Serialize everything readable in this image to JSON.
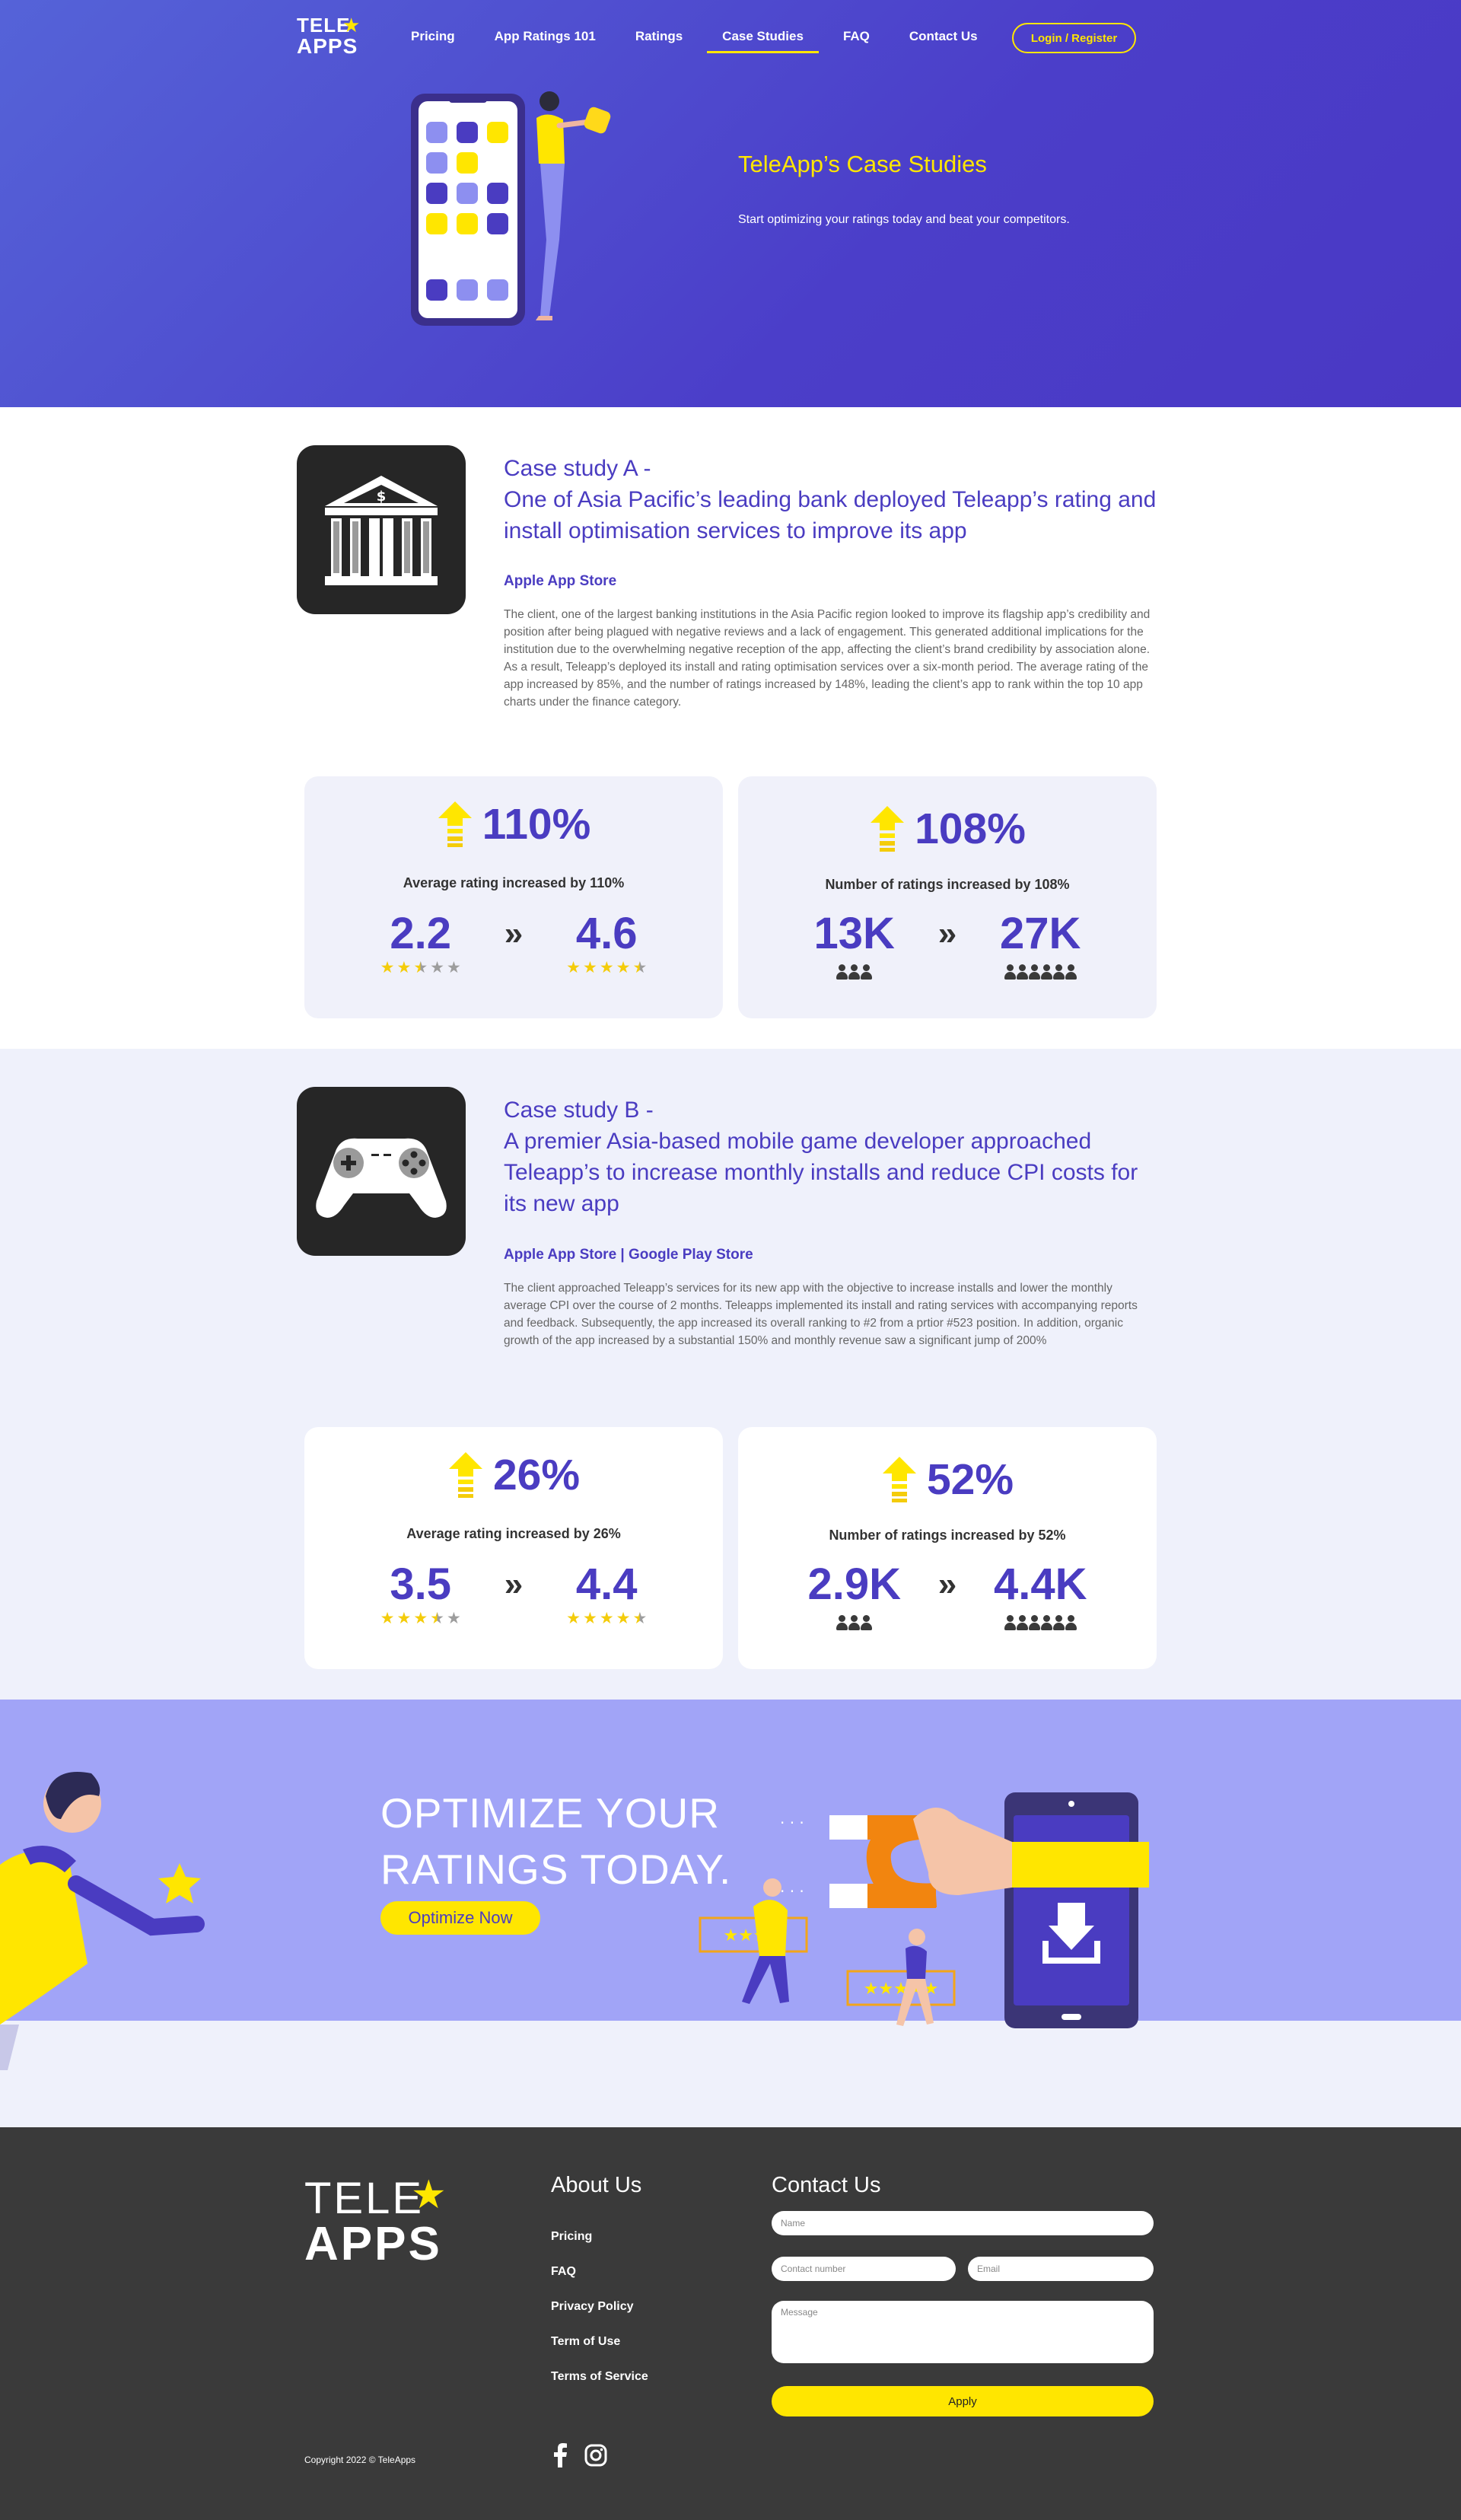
{
  "brand": {
    "logo_line1": "TELE",
    "logo_line2": "APPS"
  },
  "nav": {
    "items": [
      {
        "label": "Pricing"
      },
      {
        "label": "App Ratings 101"
      },
      {
        "label": "Ratings"
      },
      {
        "label": "Case Studies",
        "active": true
      },
      {
        "label": "FAQ"
      },
      {
        "label": "Contact Us"
      }
    ],
    "login_label": "Login / Register"
  },
  "hero": {
    "title": "TeleApp’s Case Studies",
    "subtitle": "Start optimizing your ratings today and beat your competitors."
  },
  "case_a": {
    "icon": "bank-icon",
    "title_line1": "Case study A -",
    "title_line2": "One of Asia Pacific’s leading bank deployed Teleapp’s rating and install optimisation services to improve its app",
    "store": "Apple App Store",
    "body_p1": "The client, one of the largest banking institutions in the Asia Pacific region looked to improve its flagship app’s credibility and position after being plagued with negative reviews and a lack of engagement. This generated additional implications for the institution due to the overwhelming negative reception of the app, affecting the client’s brand credibility by association alone.",
    "body_p2": "As a result, Teleapp’s deployed its install and rating optimisation services over a six-month period. The average rating of the app increased by 85%, and the number of ratings increased by 148%, leading the client’s app to rank within the top 10 app charts under the finance category.",
    "stat1": {
      "pct": "110%",
      "label": "Average rating increased by 110%",
      "from": "2.2",
      "to": "4.6",
      "from_stars": 2.5,
      "to_stars": 4.5
    },
    "stat2": {
      "pct": "108%",
      "label": "Number of ratings increased by 108%",
      "from": "13K",
      "to": "27K",
      "from_people": 3,
      "to_people": 6
    }
  },
  "case_b": {
    "icon": "gamepad-icon",
    "title_line1": "Case study B -",
    "title_line2": "A premier Asia-based mobile game developer approached Teleapp’s to increase monthly installs and reduce CPI costs for its new app",
    "store": "Apple App Store | Google Play Store",
    "body_p1": "The client approached Teleapp’s services for its new app with the objective to increase installs and lower the monthly average CPI over the course of 2 months. Teleapps implemented its install and rating services with accompanying reports and feedback. Subsequently, the app increased its overall ranking to #2 from a prtior #523 position. In addition, organic growth of the app increased by a substantial 150% and monthly revenue saw a significant jump of 200%",
    "stat1": {
      "pct": "26%",
      "label": "Average rating increased by 26%",
      "from": "3.5",
      "to": "4.4",
      "from_stars": 3.5,
      "to_stars": 4.5
    },
    "stat2": {
      "pct": "52%",
      "label": "Number of ratings increased by 52%",
      "from": "2.9K",
      "to": "4.4K",
      "from_people": 3,
      "to_people": 6
    }
  },
  "cta": {
    "title_line1": "OPTIMIZE YOUR",
    "title_line2": "RATINGS TODAY.",
    "button": "Optimize Now"
  },
  "footer": {
    "about_title": "About Us",
    "links": [
      {
        "label": "Pricing"
      },
      {
        "label": "FAQ"
      },
      {
        "label": "Privacy Policy"
      },
      {
        "label": "Term of Use"
      },
      {
        "label": "Terms of Service"
      }
    ],
    "contact_title": "Contact Us",
    "name_placeholder": "Name",
    "contact_placeholder": "Contact number",
    "email_placeholder": "Email",
    "message_placeholder": "Message",
    "apply": "Apply",
    "copyright": "Copyright 2022 © TeleApps",
    "social": [
      "facebook-icon",
      "instagram-icon"
    ]
  },
  "colors": {
    "primary": "#4a3cc1",
    "accent": "#ffe600",
    "cta_bg": "#a1a4f7",
    "footer_bg": "#3a3a3a"
  }
}
